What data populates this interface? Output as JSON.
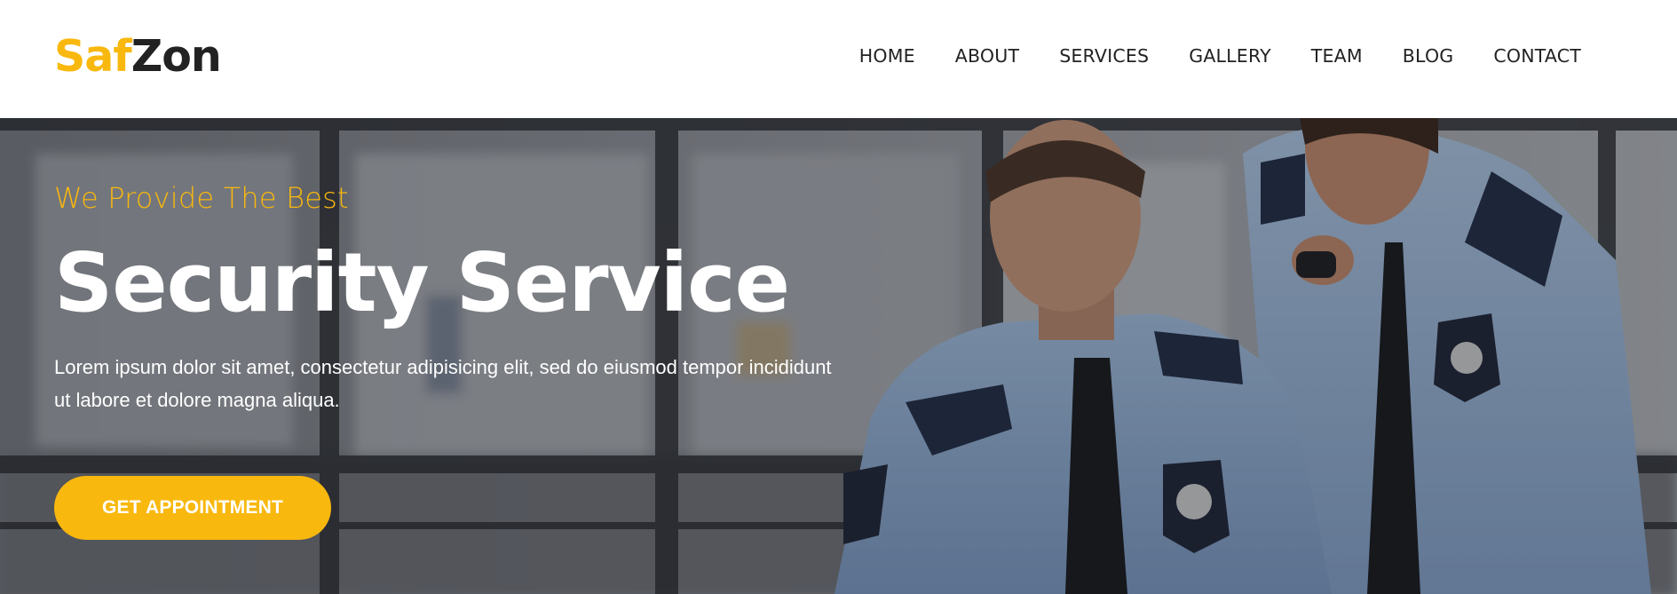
{
  "brand": {
    "logo_part1": "Saf",
    "logo_part2": "Zon",
    "accent_color": "#f9b80e",
    "dark_color": "#222222"
  },
  "nav": {
    "items": [
      {
        "label": "HOME"
      },
      {
        "label": "ABOUT"
      },
      {
        "label": "SERVICES"
      },
      {
        "label": "GALLERY"
      },
      {
        "label": "TEAM"
      },
      {
        "label": "BLOG"
      },
      {
        "label": "CONTACT"
      }
    ]
  },
  "hero": {
    "tagline": "We Provide The Best",
    "headline": "Security Service",
    "description": "Lorem ipsum dolor sit amet, consectetur adipisicing elit, sed do eiusmod tempor incididunt ut labore et dolore magna aliqua.",
    "cta_label": "GET APPOINTMENT",
    "background_image": "two-security-guards-in-office-photo"
  }
}
